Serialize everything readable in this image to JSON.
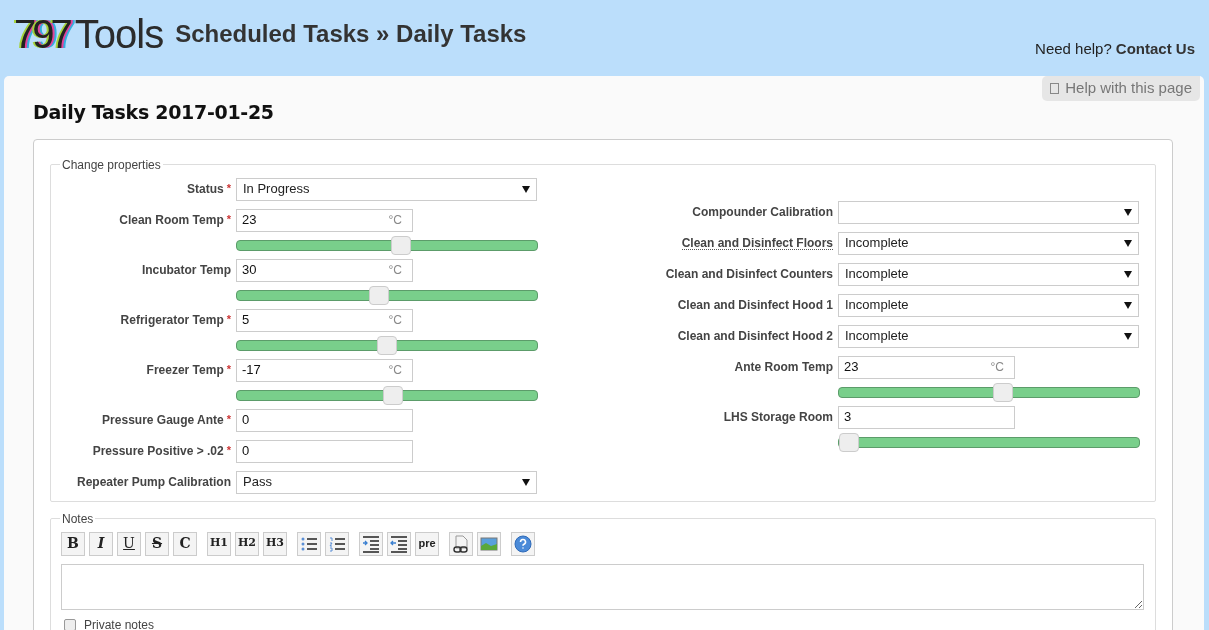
{
  "header": {
    "logo_number": "797",
    "logo_word": "Tools",
    "breadcrumb": "Scheduled Tasks » Daily Tasks",
    "help_prompt": "Need help?",
    "contact_link": "Contact Us"
  },
  "help_tab": "Help with this page",
  "page_title": "Daily Tasks 2017-01-25",
  "properties": {
    "legend": "Change properties",
    "left": [
      {
        "kind": "select",
        "label": "Status",
        "required_mark": "*",
        "value": "In Progress"
      },
      {
        "kind": "input",
        "label": "Clean Room Temp",
        "required_mark": "*",
        "value": "23",
        "unit": "°C",
        "level": 0.55
      },
      {
        "kind": "input",
        "label": "Incubator Temp",
        "value": "30",
        "unit": "°C",
        "level": 0.47
      },
      {
        "kind": "input",
        "label": "Refrigerator Temp",
        "required_mark": "*",
        "value": "5",
        "unit": "°C",
        "level": 0.5
      },
      {
        "kind": "input",
        "label": "Freezer Temp",
        "required_mark": "*",
        "value": "-17",
        "unit": "°C",
        "level": 0.52
      },
      {
        "kind": "input",
        "label": "Pressure Gauge Ante",
        "required_mark": "*",
        "value": "0"
      },
      {
        "kind": "input",
        "label": "Pressure Positive > .02",
        "required_mark": "*",
        "value": "0"
      },
      {
        "kind": "select",
        "label": "Repeater Pump Calibration",
        "value": "Pass"
      }
    ],
    "right": [
      {
        "kind": "select",
        "label": "Compounder Calibration",
        "tooltip": false
      },
      {
        "kind": "select",
        "label": "Clean and Disinfect Floors",
        "tooltip": true,
        "value": "Incomplete"
      },
      {
        "kind": "select",
        "label": "Clean and Disinfect Counters",
        "tooltip": false,
        "value": "Incomplete"
      },
      {
        "kind": "select",
        "label": "Clean and Disinfect Hood 1",
        "tooltip": false,
        "value": "Incomplete"
      },
      {
        "kind": "select",
        "label": "Clean and Disinfect Hood 2",
        "tooltip": false,
        "value": "Incomplete"
      },
      {
        "kind": "input",
        "label": "Ante Room Temp",
        "tooltip": false,
        "value": "23",
        "unit": "°C",
        "level": 0.55
      },
      {
        "kind": "input",
        "label": "LHS Storage Room",
        "tooltip": false,
        "value": "3",
        "level": 0.0
      }
    ]
  },
  "notes": {
    "legend": "Notes",
    "toolbar": [
      [
        {
          "kind": "bold",
          "label": "B"
        },
        {
          "kind": "italic",
          "label": "I"
        },
        {
          "kind": "underline",
          "label": "U"
        },
        {
          "kind": "strike",
          "label": "S"
        },
        {
          "kind": "bold",
          "label": "C"
        }
      ],
      [
        {
          "kind": "heading",
          "label": "H1"
        },
        {
          "kind": "heading",
          "label": "H2"
        },
        {
          "kind": "heading",
          "label": "H3"
        }
      ],
      [
        {
          "kind": "bullet-list"
        },
        {
          "kind": "numbered-list"
        }
      ],
      [
        {
          "kind": "indent"
        },
        {
          "kind": "outdent"
        },
        {
          "kind": "plain",
          "label": "pre"
        }
      ],
      [
        {
          "kind": "link"
        },
        {
          "kind": "image"
        }
      ],
      [
        {
          "kind": "help"
        }
      ]
    ],
    "private_label": "Private notes",
    "private_checked": false
  }
}
